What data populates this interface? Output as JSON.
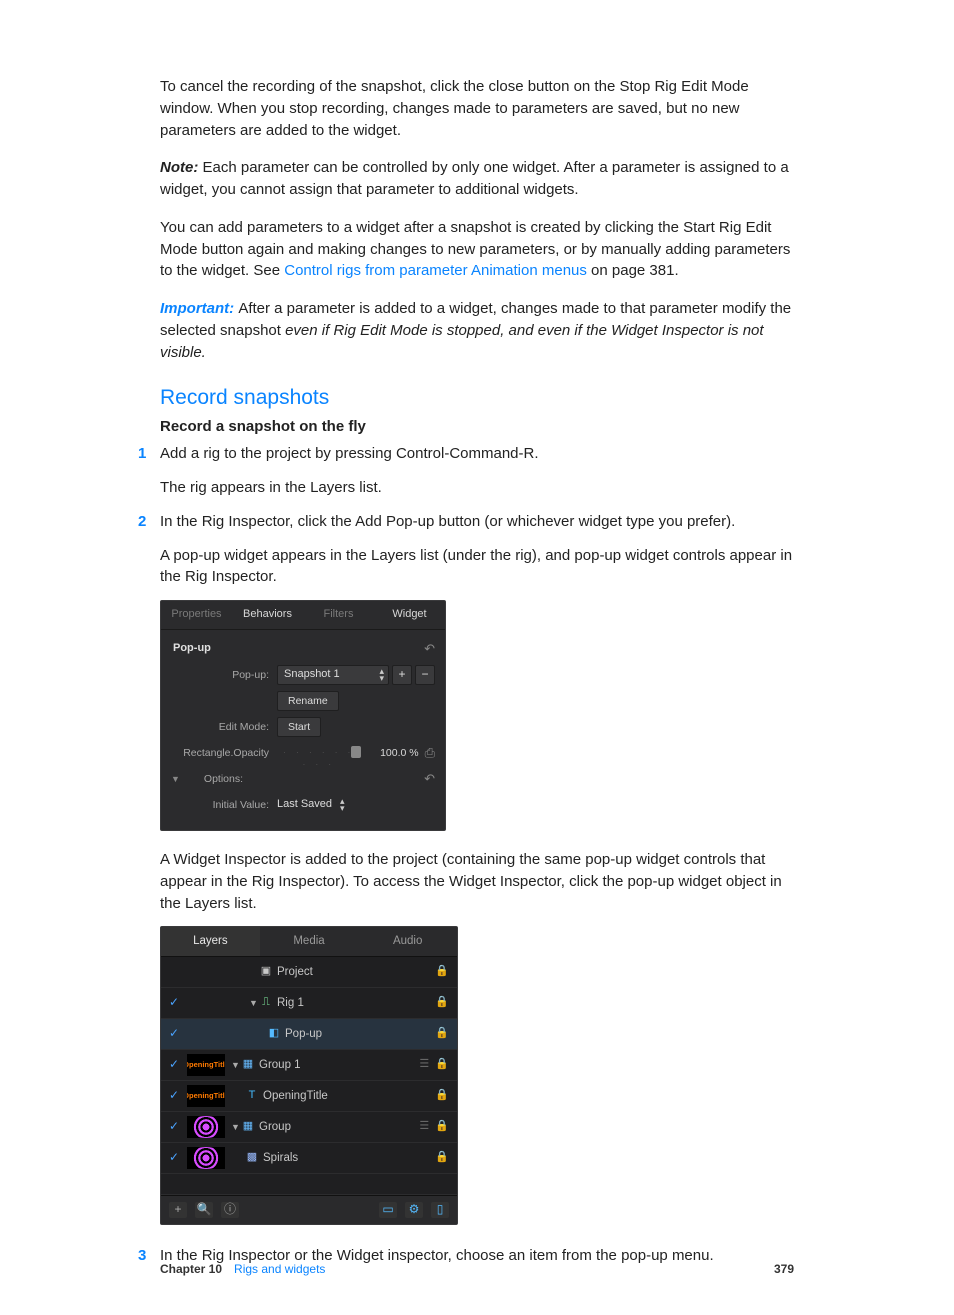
{
  "paragraphs": {
    "p1": "To cancel the recording of the snapshot, click the close button on the Stop Rig Edit Mode window. When you stop recording, changes made to parameters are saved, but no new parameters are added to the widget.",
    "note_label": "Note:  ",
    "note_body": "Each parameter can be controlled by only one widget. After a parameter is assigned to a widget, you cannot assign that parameter to additional widgets.",
    "p3a": "You can add parameters to a widget after a snapshot is created by clicking the Start Rig Edit Mode button again and making changes to new parameters, or by manually adding parameters to the widget. See ",
    "p3_link": "Control rigs from parameter Animation menus",
    "p3b": " on page 381.",
    "important_label": "Important:  ",
    "important_body_a": "After a parameter is added to a widget, changes made to that parameter modify the selected snapshot ",
    "important_body_italic": "even if Rig Edit Mode is stopped, and even if the Widget Inspector is not visible."
  },
  "section_heading": "Record snapshots",
  "sub_heading": "Record a snapshot on the fly",
  "steps": {
    "s1": {
      "num": "1",
      "text": "Add a rig to the project by pressing Control-Command-R.",
      "follow": "The rig appears in the Layers list."
    },
    "s2": {
      "num": "2",
      "text": "In the Rig Inspector, click the Add Pop-up button (or whichever widget type you prefer).",
      "follow": "A pop-up widget appears in the Layers list (under the rig), and pop-up widget controls appear in the Rig Inspector.",
      "after_panel": "A Widget Inspector is added to the project (containing the same pop-up widget controls that appear in the Rig Inspector). To access the Widget Inspector, click the pop-up widget object in the Layers list."
    },
    "s3": {
      "num": "3",
      "text": "In the Rig Inspector or the Widget inspector, choose an item from the pop-up menu."
    }
  },
  "inspector": {
    "tabs": {
      "t1": "Properties",
      "t2": "Behaviors",
      "t3": "Filters",
      "t4": "Widget"
    },
    "section": "Pop-up",
    "popup_label": "Pop-up:",
    "popup_value": "Snapshot 1",
    "rename": "Rename",
    "edit_mode_label": "Edit Mode:",
    "edit_mode_button": "Start",
    "opacity_label": "Rectangle.Opacity",
    "opacity_value": "100.0 %",
    "options_label": "Options:",
    "initial_value_label": "Initial Value:",
    "initial_value": "Last Saved"
  },
  "layers": {
    "tabs": {
      "t1": "Layers",
      "t2": "Media",
      "t3": "Audio"
    },
    "rows": {
      "project": "Project",
      "rig": "Rig 1",
      "popup": "Pop-up",
      "group1": "Group 1",
      "opening_thumb": "OpeningTitle",
      "opening": "OpeningTitle",
      "group": "Group",
      "spirals": "Spirals"
    }
  },
  "footer": {
    "chapter_label": "Chapter 10",
    "chapter_title": "Rigs and widgets",
    "page_num": "379"
  }
}
